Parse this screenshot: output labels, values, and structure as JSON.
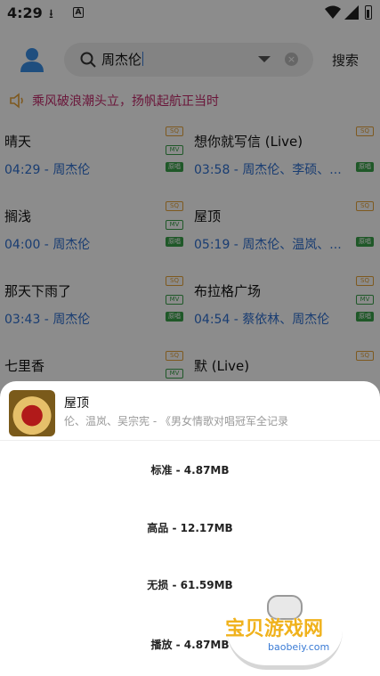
{
  "status_bar": {
    "time": "4:29",
    "download_glyph": "⭳",
    "a_glyph": "A"
  },
  "search": {
    "value": "周杰伦",
    "button_label": "搜索"
  },
  "notice": {
    "text": "乘风破浪潮头立，扬帆起航正当时"
  },
  "songs": [
    {
      "title": "晴天",
      "duration": "04:29",
      "artist": "周杰伦",
      "badges": [
        "SQ",
        "MV",
        "原唱"
      ]
    },
    {
      "title": "想你就写信 (Live)",
      "duration": "03:58",
      "artist": "周杰伦、李硕、...",
      "badges": [
        "SQ",
        "原唱"
      ]
    },
    {
      "title": "搁浅",
      "duration": "04:00",
      "artist": "周杰伦",
      "badges": [
        "SQ",
        "MV",
        "原唱"
      ]
    },
    {
      "title": "屋顶",
      "duration": "05:19",
      "artist": "周杰伦、温岚、...",
      "badges": [
        "SQ",
        "原唱"
      ]
    },
    {
      "title": "那天下雨了",
      "duration": "03:43",
      "artist": "周杰伦",
      "badges": [
        "SQ",
        "MV",
        "原唱"
      ]
    },
    {
      "title": "布拉格广场",
      "duration": "04:54",
      "artist": "蔡依林、周杰伦",
      "badges": [
        "SQ",
        "MV",
        "原唱"
      ]
    },
    {
      "title": "七里香",
      "duration": "",
      "artist": "",
      "badges": [
        "SQ",
        "MV"
      ]
    },
    {
      "title": "默 (Live)",
      "duration": "",
      "artist": "",
      "badges": [
        "SQ"
      ]
    }
  ],
  "sheet": {
    "title": "屋顶",
    "subtitle": "伦、温岚、吴宗宪 - 《男女情歌对唱冠军全记录",
    "options": [
      {
        "label": "标准 - 4.87MB"
      },
      {
        "label": "高品 - 12.17MB"
      },
      {
        "label": "无损 - 61.59MB"
      },
      {
        "label": "播放 - 4.87MB"
      }
    ]
  },
  "watermark": {
    "text": "宝贝游戏网",
    "url": "baobeiy.com"
  },
  "colors": {
    "accent": "#2f6fd0",
    "notice": "#c2296a",
    "sq": "#e6a33a",
    "mv": "#3aa04a"
  }
}
